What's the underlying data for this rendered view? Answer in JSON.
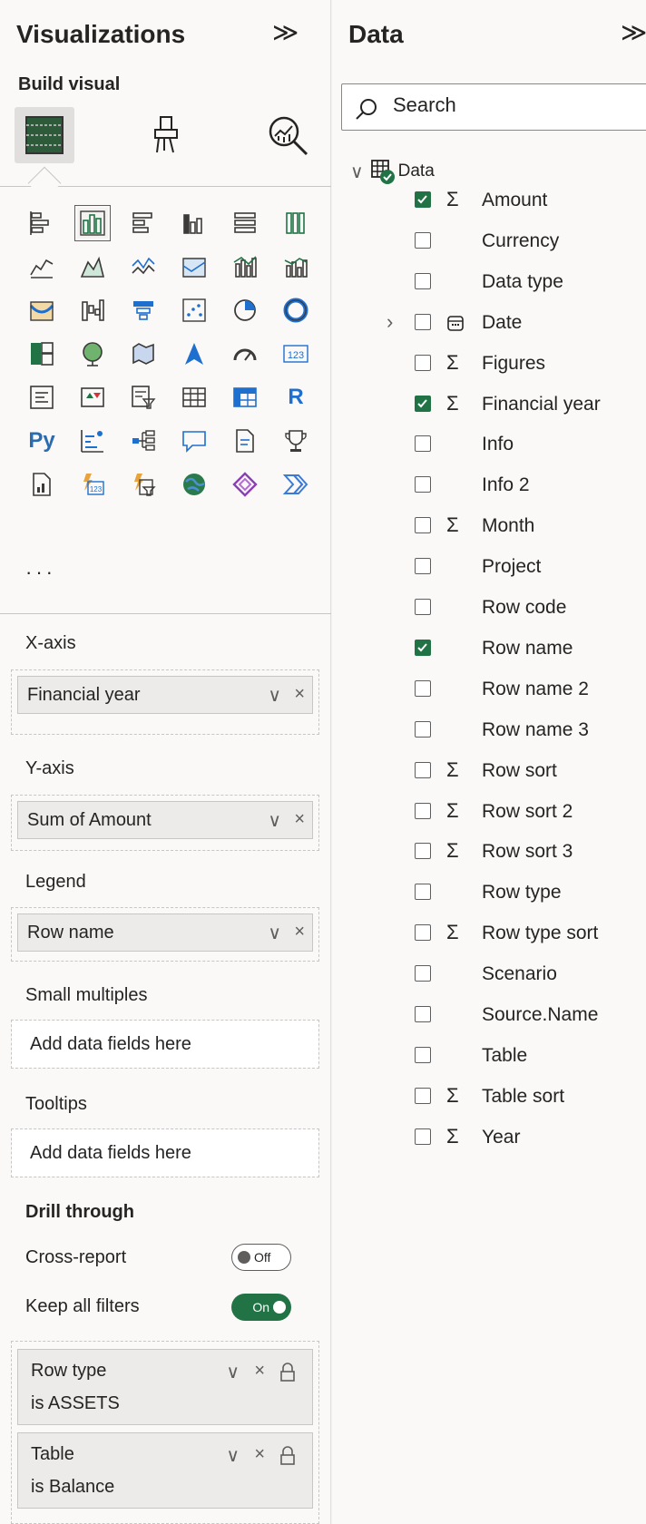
{
  "visualizations": {
    "title": "Visualizations",
    "collapse_glyph": "≫",
    "build_label": "Build visual",
    "more": "···",
    "wells": {
      "x_axis": {
        "label": "X-axis",
        "field": "Financial year"
      },
      "y_axis": {
        "label": "Y-axis",
        "field": "Sum of Amount"
      },
      "legend": {
        "label": "Legend",
        "field": "Row name"
      },
      "small_multiples": {
        "label": "Small multiples",
        "placeholder": "Add data fields here"
      },
      "tooltips": {
        "label": "Tooltips",
        "placeholder": "Add data fields here"
      }
    },
    "drill_through": {
      "label": "Drill through",
      "cross_report": {
        "label": "Cross-report",
        "state": "Off"
      },
      "keep_all_filters": {
        "label": "Keep all filters",
        "state": "On"
      },
      "filters": [
        {
          "field": "Row type",
          "condition": "is ASSETS"
        },
        {
          "field": "Table",
          "condition": "is Balance"
        }
      ]
    },
    "pill_controls": {
      "dropdown": "∨",
      "remove": "×"
    }
  },
  "data": {
    "title": "Data",
    "collapse_glyph": "≫",
    "search": {
      "placeholder": "Search"
    },
    "root": {
      "label": "Data",
      "expander": "∨"
    },
    "fields": [
      {
        "name": "Amount",
        "checked": true,
        "sigma": true
      },
      {
        "name": "Currency",
        "checked": false,
        "sigma": false
      },
      {
        "name": "Data type",
        "checked": false,
        "sigma": false
      },
      {
        "name": "Date",
        "checked": false,
        "sigma": false,
        "expandable": true,
        "icon": "calendar-icon"
      },
      {
        "name": "Figures",
        "checked": false,
        "sigma": true
      },
      {
        "name": "Financial year",
        "checked": true,
        "sigma": true
      },
      {
        "name": "Info",
        "checked": false,
        "sigma": false
      },
      {
        "name": "Info 2",
        "checked": false,
        "sigma": false
      },
      {
        "name": "Month",
        "checked": false,
        "sigma": true
      },
      {
        "name": "Project",
        "checked": false,
        "sigma": false
      },
      {
        "name": "Row code",
        "checked": false,
        "sigma": false
      },
      {
        "name": "Row name",
        "checked": true,
        "sigma": false
      },
      {
        "name": "Row name 2",
        "checked": false,
        "sigma": false
      },
      {
        "name": "Row name 3",
        "checked": false,
        "sigma": false
      },
      {
        "name": "Row sort",
        "checked": false,
        "sigma": true
      },
      {
        "name": "Row sort 2",
        "checked": false,
        "sigma": true
      },
      {
        "name": "Row sort 3",
        "checked": false,
        "sigma": true
      },
      {
        "name": "Row type",
        "checked": false,
        "sigma": false
      },
      {
        "name": "Row type sort",
        "checked": false,
        "sigma": true
      },
      {
        "name": "Scenario",
        "checked": false,
        "sigma": false
      },
      {
        "name": "Source.Name",
        "checked": false,
        "sigma": false
      },
      {
        "name": "Table",
        "checked": false,
        "sigma": false
      },
      {
        "name": "Table sort",
        "checked": false,
        "sigma": true
      },
      {
        "name": "Year",
        "checked": false,
        "sigma": true
      }
    ],
    "sigma_glyph": "Σ",
    "expand_glyph": "›"
  },
  "colors": {
    "accent_green": "#217346",
    "r_blue": "#1f6fcf",
    "py_blue": "#2b6cb0"
  },
  "visual_types": [
    "stacked-bar-chart-icon",
    "stacked-column-chart-icon",
    "clustered-bar-chart-icon",
    "clustered-column-chart-icon",
    "100pct-stacked-bar-chart-icon",
    "100pct-stacked-column-chart-icon",
    "line-chart-icon",
    "area-chart-icon",
    "stacked-area-chart-icon",
    "100pct-stacked-area-chart-icon",
    "line-and-stacked-column-chart-icon",
    "line-and-clustered-column-chart-icon",
    "ribbon-chart-icon",
    "waterfall-chart-icon",
    "funnel-chart-icon",
    "scatter-chart-icon",
    "pie-chart-icon",
    "donut-chart-icon",
    "treemap-icon",
    "map-icon",
    "filled-map-icon",
    "azure-map-icon",
    "gauge-icon",
    "card-icon",
    "multi-row-card-icon",
    "kpi-icon",
    "slicer-icon",
    "table-icon",
    "matrix-icon",
    "r-visual-icon",
    "python-visual-icon",
    "key-influencers-icon",
    "decomposition-tree-icon",
    "qna-icon",
    "smart-narrative-icon",
    "metrics-icon",
    "paginated-report-icon",
    "power-apps-card-icon",
    "power-apps-slicer-icon",
    "arcgis-map-icon",
    "power-apps-icon",
    "power-automate-icon"
  ],
  "visual_glyphs": {
    "r": "R",
    "py": "Py",
    "card": "123"
  }
}
